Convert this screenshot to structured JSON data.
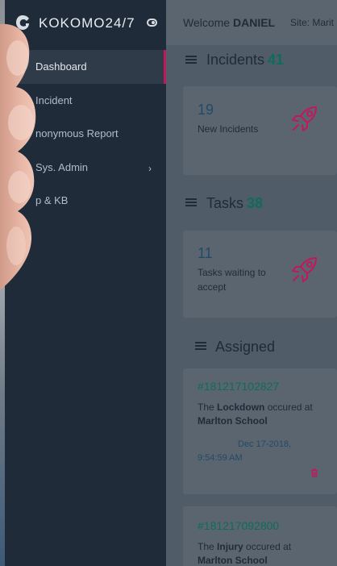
{
  "brand": {
    "name": "KOKOMO24/7"
  },
  "sidebar": {
    "items": [
      {
        "label": "Dashboard"
      },
      {
        "label": "Incident"
      },
      {
        "label": "nonymous Report"
      },
      {
        "label": "Sys. Admin"
      },
      {
        "label": "p & KB"
      }
    ]
  },
  "topbar": {
    "welcome_prefix": "Welcome",
    "user": "DANIEL",
    "site": "Site: Marit"
  },
  "incidents": {
    "title": "Incidents",
    "count": "41",
    "card_number": "19",
    "card_label": "New Incidents"
  },
  "tasks": {
    "title": "Tasks",
    "count": "38",
    "card_number": "11",
    "card_label": "Tasks waiting to accept"
  },
  "assigned": {
    "title": "Assigned",
    "items": [
      {
        "number": "#181217102827",
        "desc_prefix": "The",
        "type": "Lockdown",
        "desc_mid": "occured at",
        "place": "Marlton School",
        "date": "Dec 17-2018, 9:54:59 AM"
      },
      {
        "number": "#181217092800",
        "desc_prefix": "The",
        "type": "Injury",
        "desc_mid": "occured at",
        "place": "Marlton School"
      }
    ]
  },
  "colors": {
    "sidebar_bg": "#1f2b38",
    "active_indicator": "#c2185b",
    "count_accent": "#0f6b5e",
    "rocket": "#c2185b"
  }
}
